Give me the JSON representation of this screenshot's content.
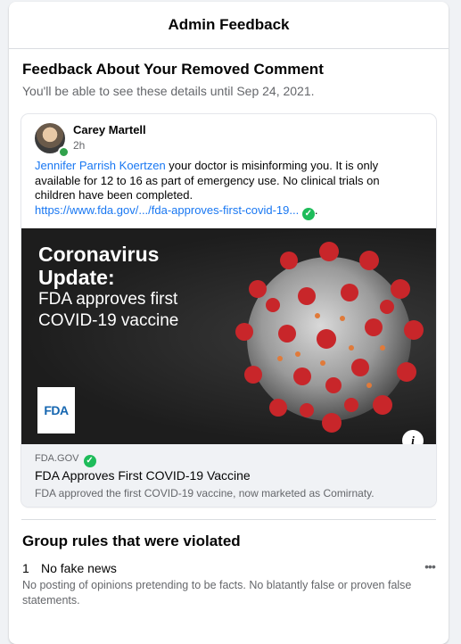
{
  "header": {
    "title": "Admin Feedback"
  },
  "section": {
    "title": "Feedback About Your Removed Comment",
    "subtitle": "You'll be able to see these details until Sep 24, 2021."
  },
  "comment": {
    "author": "Carey Martell",
    "time": "2h",
    "mention": "Jennifer Parrish Koertzen",
    "text": " your doctor is misinforming you. It is only available for 12 to 16 as part of emergency use. No clinical trials on children have been completed.",
    "link_text": "https://www.fda.gov/.../fda-approves-first-covid-19...",
    "link_suffix": ".",
    "verified_icon": "check-circle-icon"
  },
  "hero": {
    "title_line1": "Coronavirus",
    "title_line2": "Update:",
    "sub_line1": "FDA approves first",
    "sub_line2": "COVID-19 vaccine",
    "logo_text": "FDA",
    "info_label": "i"
  },
  "link_preview": {
    "domain": "FDA.GOV",
    "title": "FDA Approves First COVID-19 Vaccine",
    "description": "FDA approved the first COVID-19 vaccine, now marketed as Comirnaty."
  },
  "rules": {
    "title": "Group rules that were violated",
    "items": [
      {
        "number": "1",
        "name": "No fake news",
        "description": "No posting of opinions pretending to be facts. No blatantly false or proven false statements.",
        "more_label": "•••"
      }
    ]
  },
  "colors": {
    "accent": "#1877f2",
    "verified": "#1ebc5a",
    "online": "#31a24c",
    "secondary_text": "#65676b"
  }
}
